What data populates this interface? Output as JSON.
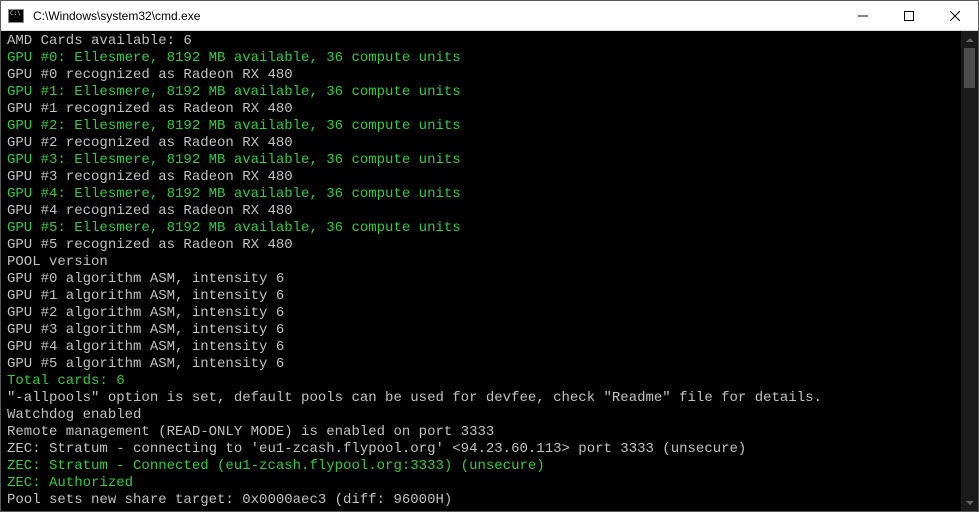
{
  "window": {
    "title": "C:\\Windows\\system32\\cmd.exe"
  },
  "controls": {
    "minimize": "minimize",
    "maximize": "maximize",
    "close": "close"
  },
  "colors": {
    "default": "#c0c0c0",
    "highlight": "#2ecc40",
    "background": "#000000"
  },
  "terminal": {
    "lines": [
      {
        "text": "AMD Cards available: 6",
        "class": ""
      },
      {
        "text": "GPU #0: Ellesmere, 8192 MB available, 36 compute units",
        "class": "g"
      },
      {
        "text": "GPU #0 recognized as Radeon RX 480",
        "class": ""
      },
      {
        "text": "GPU #1: Ellesmere, 8192 MB available, 36 compute units",
        "class": "g"
      },
      {
        "text": "GPU #1 recognized as Radeon RX 480",
        "class": ""
      },
      {
        "text": "GPU #2: Ellesmere, 8192 MB available, 36 compute units",
        "class": "g"
      },
      {
        "text": "GPU #2 recognized as Radeon RX 480",
        "class": ""
      },
      {
        "text": "GPU #3: Ellesmere, 8192 MB available, 36 compute units",
        "class": "g"
      },
      {
        "text": "GPU #3 recognized as Radeon RX 480",
        "class": ""
      },
      {
        "text": "GPU #4: Ellesmere, 8192 MB available, 36 compute units",
        "class": "g"
      },
      {
        "text": "GPU #4 recognized as Radeon RX 480",
        "class": ""
      },
      {
        "text": "GPU #5: Ellesmere, 8192 MB available, 36 compute units",
        "class": "g"
      },
      {
        "text": "GPU #5 recognized as Radeon RX 480",
        "class": ""
      },
      {
        "text": "POOL version",
        "class": ""
      },
      {
        "text": "GPU #0 algorithm ASM, intensity 6",
        "class": ""
      },
      {
        "text": "GPU #1 algorithm ASM, intensity 6",
        "class": ""
      },
      {
        "text": "GPU #2 algorithm ASM, intensity 6",
        "class": ""
      },
      {
        "text": "GPU #3 algorithm ASM, intensity 6",
        "class": ""
      },
      {
        "text": "GPU #4 algorithm ASM, intensity 6",
        "class": ""
      },
      {
        "text": "GPU #5 algorithm ASM, intensity 6",
        "class": ""
      },
      {
        "text": "Total cards: 6",
        "class": "g"
      },
      {
        "text": "\"-allpools\" option is set, default pools can be used for devfee, check \"Readme\" file for details.",
        "class": ""
      },
      {
        "text": "Watchdog enabled",
        "class": ""
      },
      {
        "text": "Remote management (READ-ONLY MODE) is enabled on port 3333",
        "class": ""
      },
      {
        "text": "",
        "class": ""
      },
      {
        "text": "ZEC: Stratum - connecting to 'eu1-zcash.flypool.org' <94.23.60.113> port 3333 (unsecure)",
        "class": ""
      },
      {
        "text": "ZEC: Stratum - Connected (eu1-zcash.flypool.org:3333) (unsecure)",
        "class": "g"
      },
      {
        "text": "ZEC: Authorized",
        "class": "g"
      },
      {
        "text": "Pool sets new share target: 0x0000aec3 (diff: 96000H)",
        "class": ""
      }
    ]
  }
}
